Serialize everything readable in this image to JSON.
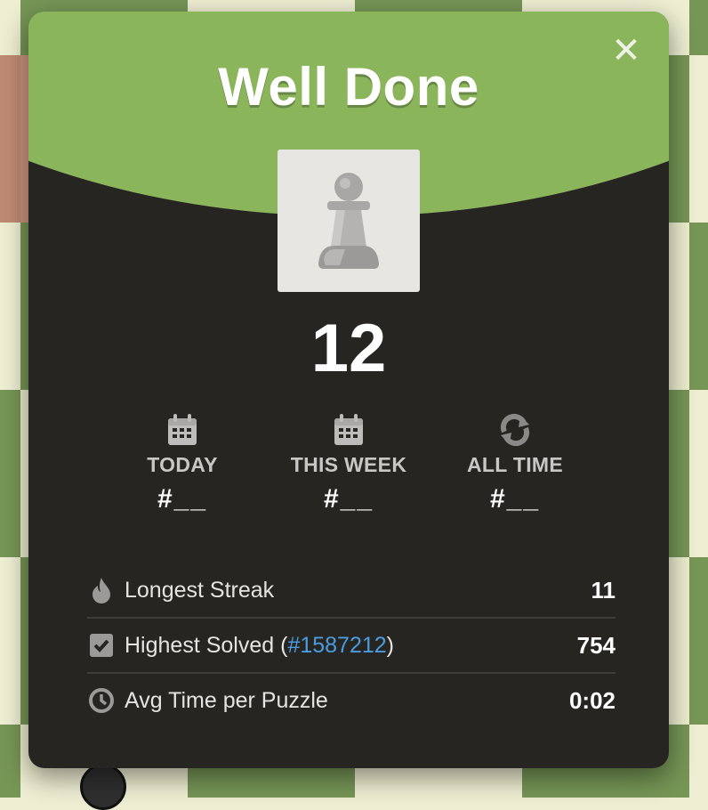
{
  "modal": {
    "title": "Well Done",
    "close_glyph": "✕",
    "score": "12",
    "ranks": [
      {
        "label": "TODAY",
        "value": "#__",
        "icon": "calendar-icon"
      },
      {
        "label": "THIS WEEK",
        "value": "#__",
        "icon": "calendar-icon"
      },
      {
        "label": "ALL TIME",
        "value": "#__",
        "icon": "refresh-icon"
      }
    ],
    "stats": {
      "longest_streak": {
        "label": "Longest Streak",
        "value": "11",
        "icon": "flame-icon"
      },
      "highest_solved": {
        "label_prefix": "Highest Solved (",
        "link": "#1587212",
        "label_suffix": ")",
        "value": "754",
        "icon": "checkbox-icon"
      },
      "avg_time": {
        "label": "Avg Time per Puzzle",
        "value": "0:02",
        "icon": "clock-icon"
      }
    }
  },
  "colors": {
    "header_green": "#8bb55b",
    "modal_bg": "#262522",
    "link_blue": "#4a9de0"
  }
}
